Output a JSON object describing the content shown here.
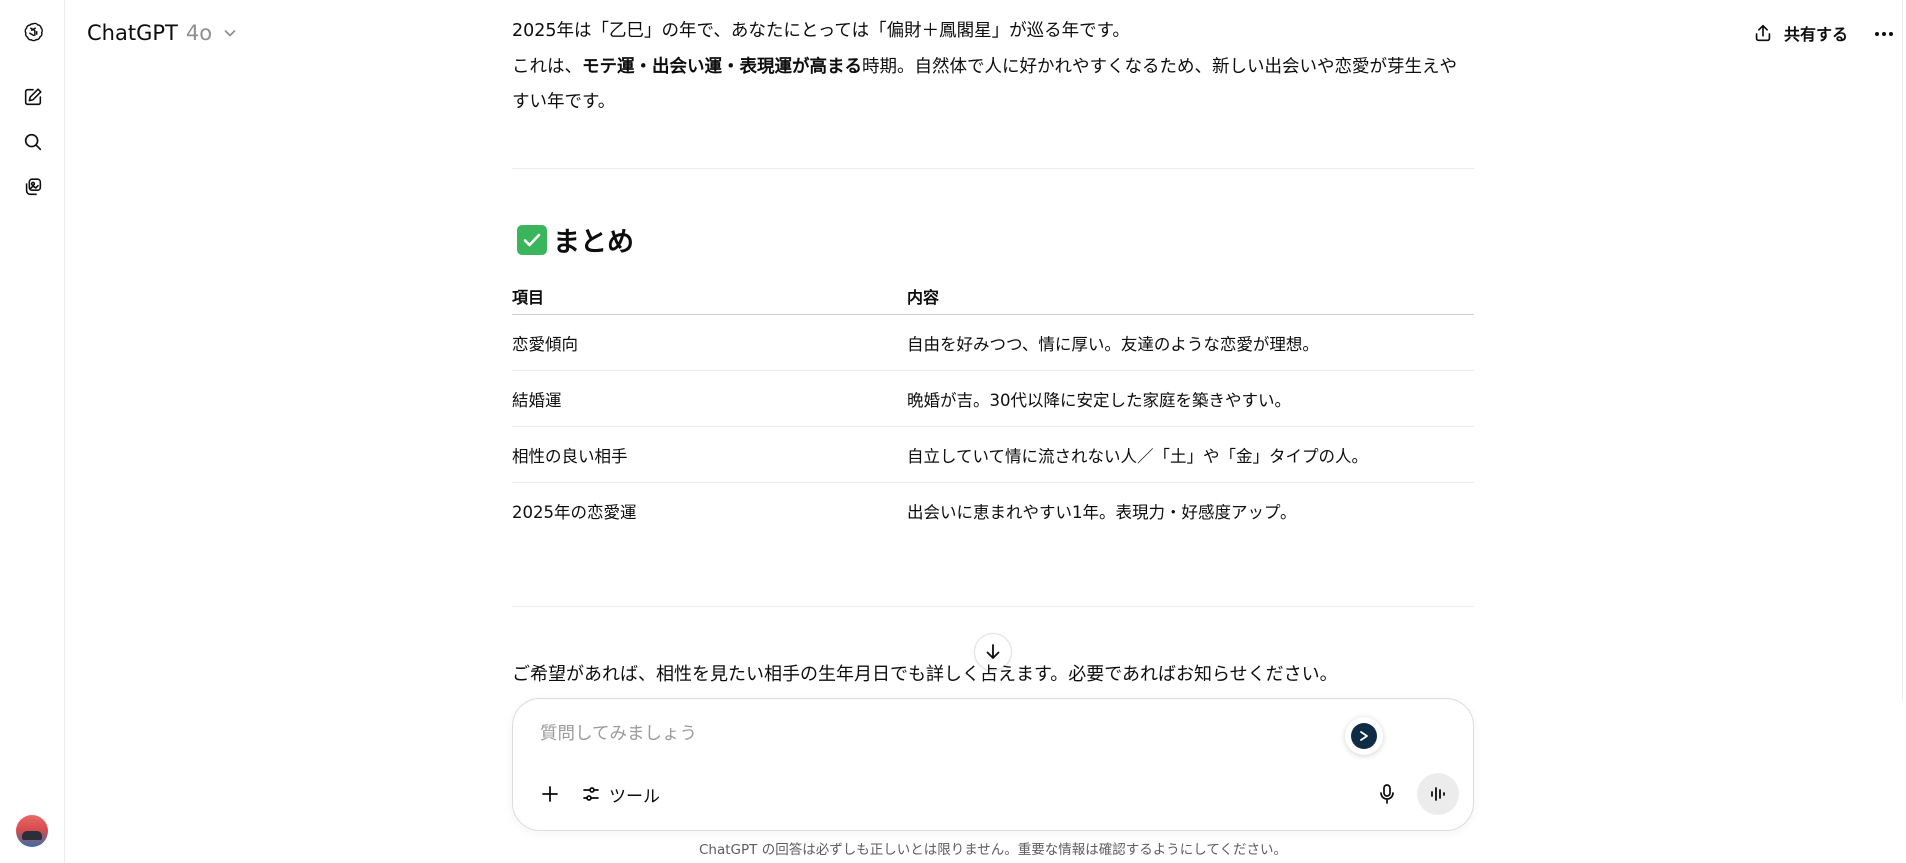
{
  "header": {
    "model_name": "ChatGPT",
    "model_version": "4o",
    "share_label": "共有する"
  },
  "sidebar": {
    "icons": [
      "openai-logo-icon",
      "new-chat-icon",
      "search-icon",
      "library-icon"
    ],
    "avatar": "avatar"
  },
  "message": {
    "intro_line1": "2025年は「乙巳」の年で、あなたにとっては「偏財＋鳳閣星」が巡る年です。",
    "intro_line2_pre": "これは、",
    "intro_line2_bold": "モテ運・出会い運・表現運が高まる",
    "intro_line2_post": "時期。自然体で人に好かれやすくなるため、新しい出会いや恋愛が芽生えやすい年です。",
    "summary_title": "まとめ",
    "table": {
      "headers": [
        "項目",
        "内容"
      ],
      "rows": [
        [
          "恋愛傾向",
          "自由を好みつつ、情に厚い。友達のような恋愛が理想。"
        ],
        [
          "結婚運",
          "晩婚が吉。30代以降に安定した家庭を築きやすい。"
        ],
        [
          "相性の良い相手",
          "自立していて情に流されない人／「土」や「金」タイプの人。"
        ],
        [
          "2025年の恋愛運",
          "出会いに恵まれやすい1年。表現力・好感度アップ。"
        ]
      ]
    },
    "closing": "ご希望があれば、相性を見たい相手の生年月日でも詳しく占えます。必要であればお知らせください。"
  },
  "composer": {
    "placeholder": "質問してみましょう",
    "tools_label": "ツール"
  },
  "footer": {
    "disclaimer": "ChatGPT の回答は必ずしも正しいとは限りません。重要な情報は確認するようにしてください。"
  },
  "colors": {
    "accent_check": "#3bb55c",
    "border": "#ececec",
    "muted_text": "#8f8f8f"
  }
}
